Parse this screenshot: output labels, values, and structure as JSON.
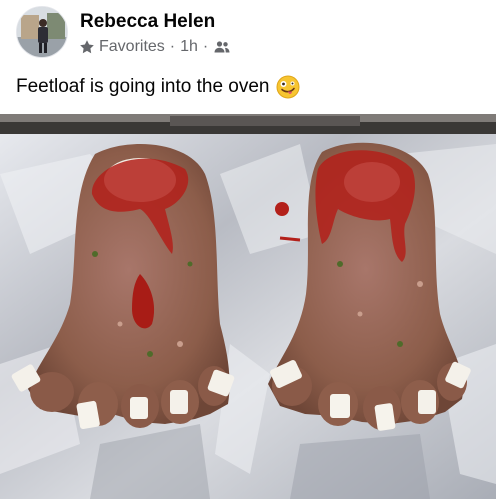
{
  "post": {
    "author_name": "Rebecca Helen",
    "audience_label": "Favorites",
    "separator": "·",
    "timestamp": "1h",
    "caption": "Feetloaf is going into the oven",
    "icons": {
      "audience": "star-icon",
      "privacy": "friends-icon",
      "emoji": "zany-face-emoji"
    },
    "photo": {
      "subject": "two meatloaves shaped like feet with onion toenails and ketchup on foil"
    },
    "colors": {
      "meta_gray": "#65676b",
      "text": "#050505",
      "foil": "#c9ccd3",
      "meat": "#9a6a56",
      "ketchup": "#b3201a"
    }
  }
}
